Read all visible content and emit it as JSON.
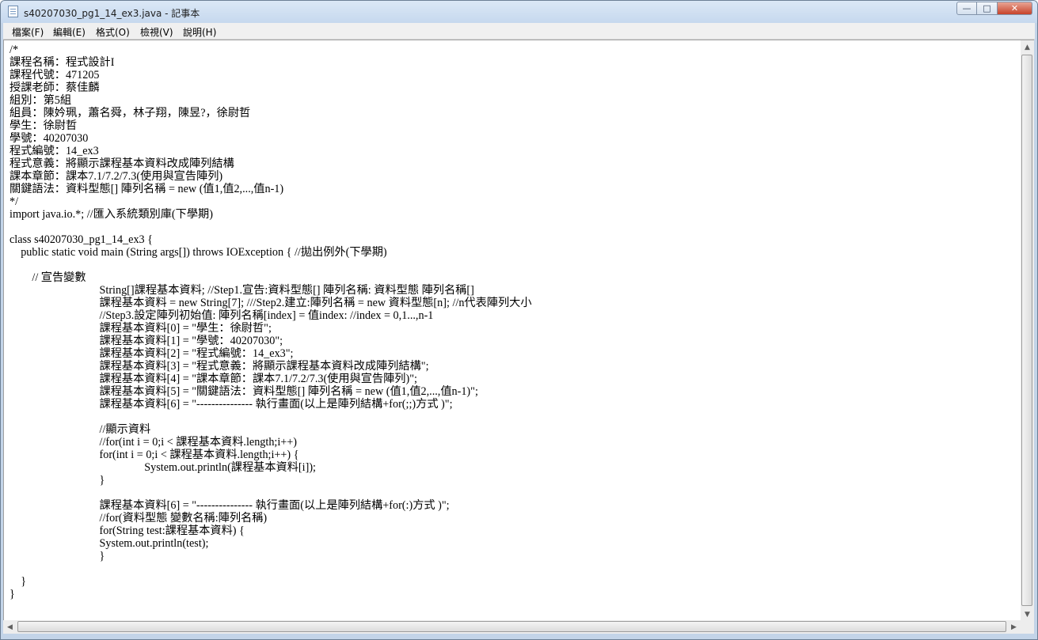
{
  "window": {
    "title": "s40207030_pg1_14_ex3.java - 記事本",
    "minimize_glyph": "—",
    "maximize_glyph": "□",
    "close_glyph": "✕"
  },
  "menu": [
    "檔案(F)",
    "編輯(E)",
    "格式(O)",
    "檢視(V)",
    "說明(H)"
  ],
  "editor": {
    "lines": [
      "/*",
      "課程名稱：程式設計I",
      "課程代號：471205",
      "授課老師：蔡佳麟",
      "組別：第5組",
      "組員：陳妗珮，蕭名舜，林子翔，陳昱?，徐尉哲",
      "學生：徐尉哲",
      "學號：40207030",
      "程式編號：14_ex3",
      "程式意義：將顯示課程基本資料改成陣列結構",
      "課本章節：課本7.1/7.2/7.3(使用與宣告陣列)",
      "關鍵語法：資料型態[] 陣列名稱 = new (值1,值2,...,值n-1)",
      "*/",
      "import java.io.*; //匯入系統類別庫(下學期)",
      "",
      "class s40207030_pg1_14_ex3 {",
      "    public static void main (String args[]) throws IOException { //拋出例外(下學期)",
      "",
      "        // 宣告變數",
      "                                String[]課程基本資料; //Step1.宣告:資料型態[] 陣列名稱: 資料型態 陣列名稱[]",
      "                                課程基本資料 = new String[7]; ///Step2.建立:陣列名稱 = new 資料型態[n]; //n代表陣列大小",
      "                                //Step3.設定陣列初始值: 陣列名稱[index] = 值index: //index = 0,1...,n-1",
      "                                課程基本資料[0] = \"學生：徐尉哲\";",
      "                                課程基本資料[1] = \"學號：40207030\";",
      "                                課程基本資料[2] = \"程式編號：14_ex3\";",
      "                                課程基本資料[3] = \"程式意義：將顯示課程基本資料改成陣列結構\";",
      "                                課程基本資料[4] = \"課本章節：課本7.1/7.2/7.3(使用與宣告陣列)\";",
      "                                課程基本資料[5] = \"關鍵語法：資料型態[] 陣列名稱 = new (值1,值2,...,值n-1)\";",
      "                                課程基本資料[6] = \"--------------- 執行畫面(以上是陣列結構+for(;;)方式 )\";",
      "",
      "                                //顯示資料",
      "                                //for(int i = 0;i < 課程基本資料.length;i++)",
      "                                for(int i = 0;i < 課程基本資料.length;i++) {",
      "                                                System.out.println(課程基本資料[i]);",
      "                                }",
      "",
      "                                課程基本資料[6] = \"--------------- 執行畫面(以上是陣列結構+for(:)方式 )\";",
      "                                //for(資料型態 變數名稱:陣列名稱)",
      "                                for(String test:課程基本資料) {",
      "                                System.out.println(test);",
      "                                }",
      "",
      "    }",
      "}"
    ]
  },
  "scrollbars": {
    "up_glyph": "▲",
    "down_glyph": "▼",
    "left_glyph": "◀",
    "right_glyph": "▶"
  }
}
